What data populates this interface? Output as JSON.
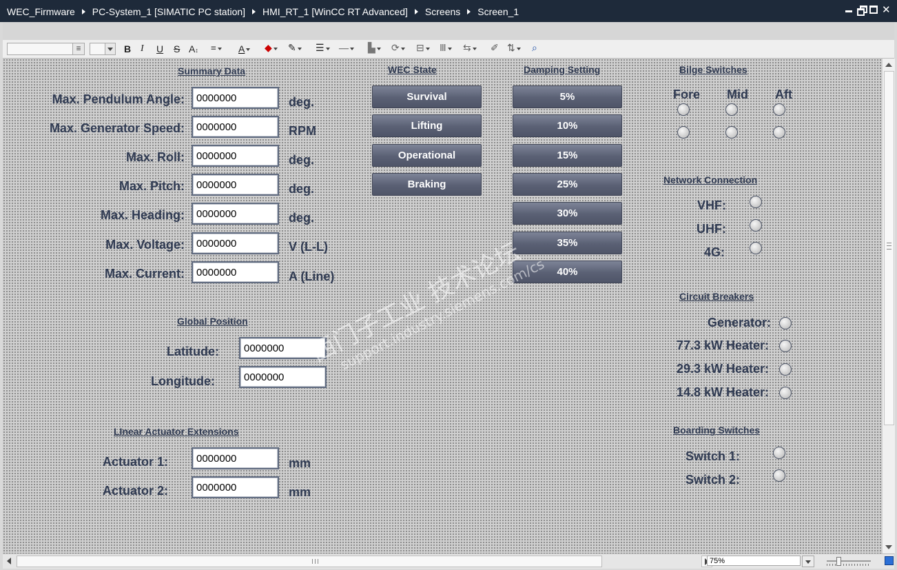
{
  "breadcrumb": [
    "WEC_Firmware",
    "PC-System_1 [SIMATIC PC station]",
    "HMI_RT_1 [WinCC RT Advanced]",
    "Screens",
    "Screen_1"
  ],
  "toolbar": {
    "bold": "B",
    "italic": "I",
    "underline": "U",
    "strike": "S",
    "font_size": "A",
    "font_color": "A"
  },
  "summary": {
    "heading": "Summary Data",
    "rows": [
      {
        "label": "Max. Pendulum Angle:",
        "value": "0000000",
        "unit": "deg."
      },
      {
        "label": "Max. Generator Speed:",
        "value": "0000000",
        "unit": "RPM"
      },
      {
        "label": "Max. Roll:",
        "value": "0000000",
        "unit": "deg."
      },
      {
        "label": "Max. Pitch:",
        "value": "0000000",
        "unit": "deg."
      },
      {
        "label": "Max. Heading:",
        "value": "0000000",
        "unit": "deg."
      },
      {
        "label": "Max. Voltage:",
        "value": "0000000",
        "unit": "V (L-L)"
      },
      {
        "label": "Max. Current:",
        "value": "0000000",
        "unit": "A (Line)"
      }
    ]
  },
  "position": {
    "heading": "Global Position",
    "rows": [
      {
        "label": "Latitude:",
        "value": "0000000"
      },
      {
        "label": "Longitude:",
        "value": "0000000"
      }
    ]
  },
  "actuators": {
    "heading": "LInear Actuator Extensions",
    "rows": [
      {
        "label": "Actuator 1:",
        "value": "0000000",
        "unit": "mm"
      },
      {
        "label": "Actuator 2:",
        "value": "0000000",
        "unit": "mm"
      }
    ]
  },
  "wec_state": {
    "heading": "WEC State",
    "buttons": [
      "Survival",
      "Lifting",
      "Operational",
      "Braking"
    ]
  },
  "damping": {
    "heading": "Damping Setting",
    "buttons": [
      "5%",
      "10%",
      "15%",
      "25%",
      "30%",
      "35%",
      "40%"
    ]
  },
  "bilge": {
    "heading": "Bilge Switches",
    "columns": [
      "Fore",
      "Mid",
      "Aft"
    ]
  },
  "network": {
    "heading": "Network Connection",
    "items": [
      "VHF:",
      "UHF:",
      "4G:"
    ]
  },
  "breakers": {
    "heading": "Circuit Breakers",
    "items": [
      "Generator:",
      "77.3 kW Heater:",
      "29.3 kW Heater:",
      "14.8 kW Heater:"
    ]
  },
  "boarding": {
    "heading": "Boarding Switches",
    "items": [
      "Switch 1:",
      "Switch 2:"
    ]
  },
  "statusbar": {
    "zoom": "75%"
  },
  "watermark": {
    "cn": "西门子工业  技术论坛",
    "url": "support.industry.siemens.com/cs"
  }
}
